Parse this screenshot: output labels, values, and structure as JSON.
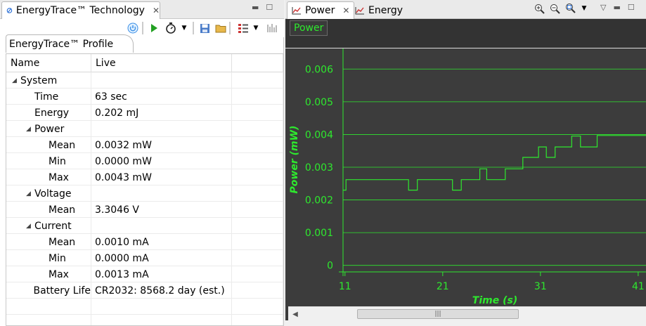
{
  "left_panel": {
    "tab_title": "EnergyTrace™ Technology",
    "subtab_title": "EnergyTrace™ Profile",
    "columns": [
      "Name",
      "Live"
    ],
    "rows": [
      {
        "name": "System",
        "value": "",
        "level": 0,
        "expanded": true
      },
      {
        "name": "Time",
        "value": "63 sec",
        "level": 1
      },
      {
        "name": "Energy",
        "value": "0.202 mJ",
        "level": 1
      },
      {
        "name": "Power",
        "value": "",
        "level": 1,
        "expanded": true
      },
      {
        "name": "Mean",
        "value": "0.0032 mW",
        "level": 2
      },
      {
        "name": "Min",
        "value": "0.0000 mW",
        "level": 2
      },
      {
        "name": "Max",
        "value": "0.0043 mW",
        "level": 2
      },
      {
        "name": "Voltage",
        "value": "",
        "level": 1,
        "expanded": true
      },
      {
        "name": "Mean",
        "value": "3.3046 V",
        "level": 2
      },
      {
        "name": "Current",
        "value": "",
        "level": 1,
        "expanded": true
      },
      {
        "name": "Mean",
        "value": "0.0010 mA",
        "level": 2
      },
      {
        "name": "Min",
        "value": "0.0000 mA",
        "level": 2
      },
      {
        "name": "Max",
        "value": "0.0013 mA",
        "level": 2
      },
      {
        "name": "Battery Life",
        "value": "CR2032: 8568.2 day (est.)",
        "level": 1
      }
    ],
    "empty_rows": 2
  },
  "right_panel": {
    "tabs": [
      {
        "label": "Power",
        "active": true,
        "closable": true
      },
      {
        "label": "Energy",
        "active": false,
        "closable": false
      }
    ],
    "chart_label": "Power"
  },
  "chart_data": {
    "type": "line",
    "xlabel": "Time  (s)",
    "ylabel": "Power  (mW)",
    "xticks": [
      11,
      21,
      31,
      41
    ],
    "yticks": [
      0,
      0.001,
      0.002,
      0.003,
      0.004,
      0.005,
      0.006
    ],
    "ytick_labels": [
      "0",
      "0.001",
      "0.002",
      "0.003",
      "0.004",
      "0.005",
      "0.006"
    ],
    "xlim": [
      10.8,
      41.8
    ],
    "ylim": [
      -0.0002,
      0.0065
    ],
    "grid": true,
    "series": [
      {
        "x": [
          10.8,
          11.1,
          11.1,
          17.5,
          17.5,
          18.4,
          18.4,
          22.0,
          22.0,
          22.9,
          22.9,
          24.8,
          24.8,
          25.5,
          25.5,
          27.4,
          27.4,
          29.2,
          29.2,
          30.8,
          30.8,
          31.6,
          31.6,
          32.5,
          32.5,
          34.2,
          34.2,
          35.1,
          35.1,
          36.8,
          36.8,
          41.8
        ],
        "y": [
          0.0023,
          0.0023,
          0.00262,
          0.00262,
          0.0023,
          0.0023,
          0.00262,
          0.00262,
          0.0023,
          0.0023,
          0.00262,
          0.00262,
          0.00295,
          0.00295,
          0.00262,
          0.00262,
          0.00295,
          0.00295,
          0.0033,
          0.0033,
          0.00362,
          0.00362,
          0.0033,
          0.0033,
          0.00362,
          0.00362,
          0.00395,
          0.00395,
          0.00362,
          0.00362,
          0.00397,
          0.00397
        ]
      }
    ],
    "colors": {
      "line": "#2ee82e",
      "grid": "#2ee82e",
      "text": "#2ee82e",
      "background": "#3c3c3c"
    }
  }
}
